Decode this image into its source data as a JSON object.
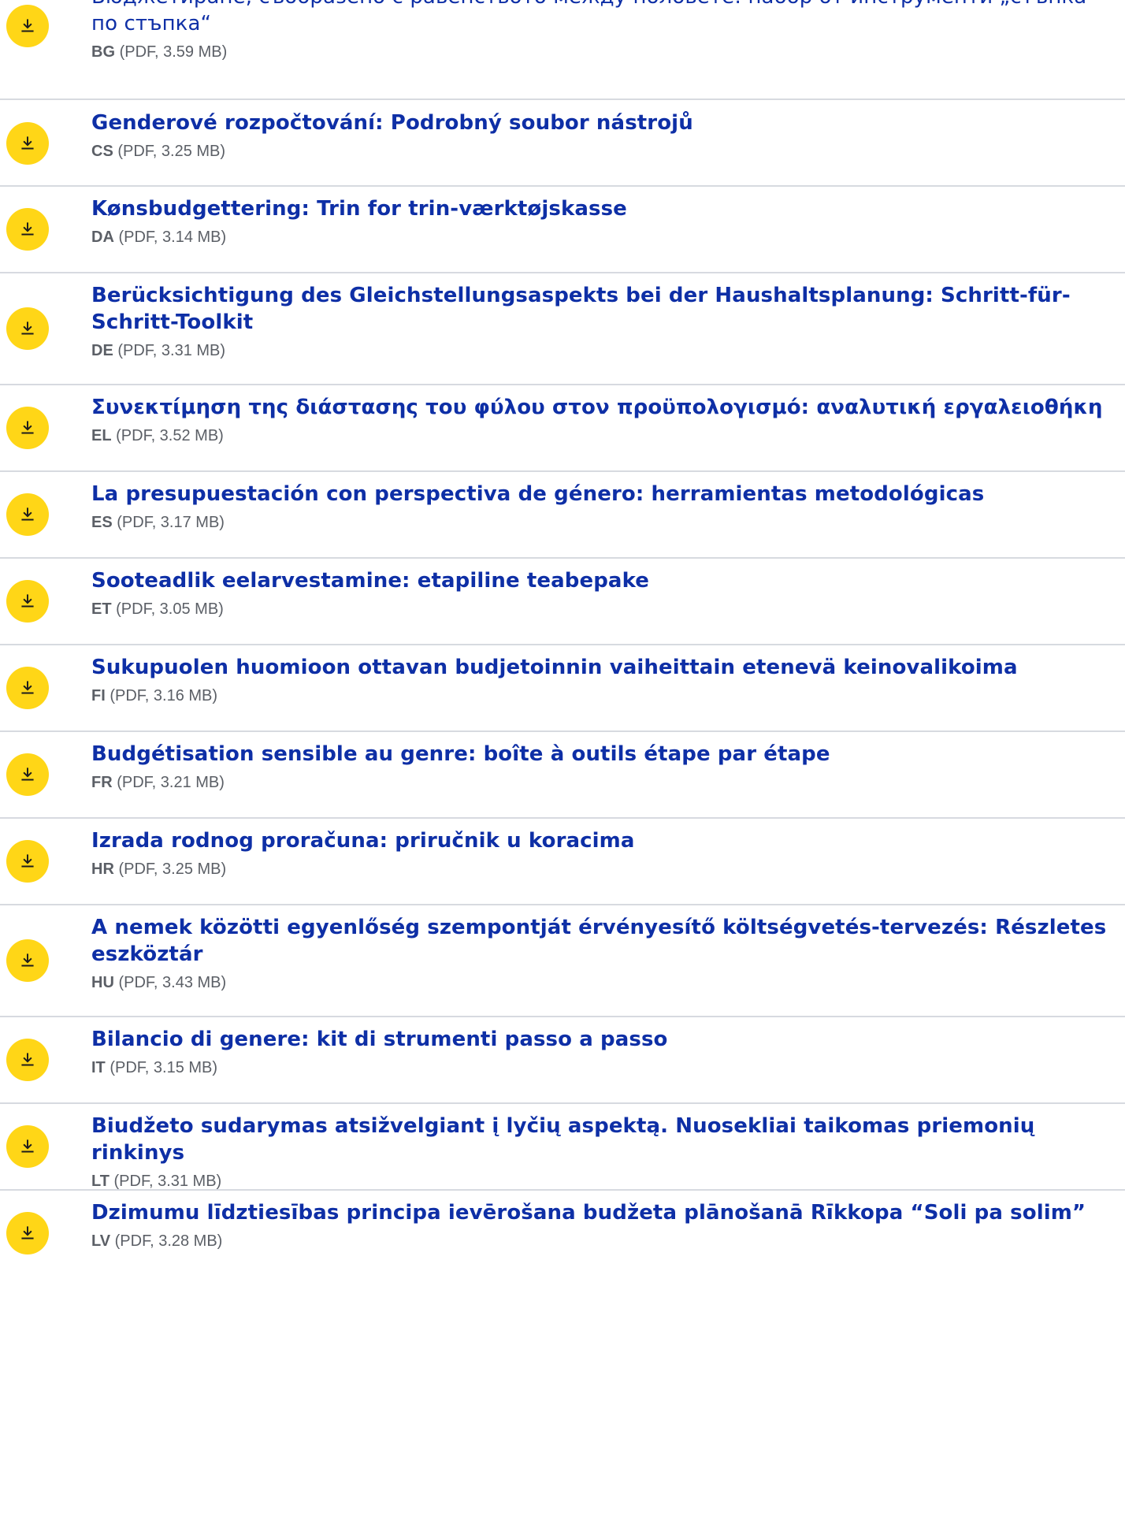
{
  "documents": [
    {
      "title": "Бюджетиране, съобразено с равенството между половете: набор от инструменти „стъпка по стъпка“",
      "lang": "BG",
      "info": "(PDF, 3.59 MB)"
    },
    {
      "title": "Genderové rozpočtování: Podrobný soubor nástrojů",
      "lang": "CS",
      "info": "(PDF, 3.25 MB)"
    },
    {
      "title": "Kønsbudgettering: Trin for trin-værktøjskasse",
      "lang": "DA",
      "info": "(PDF, 3.14 MB)"
    },
    {
      "title": "Berücksichtigung des Gleichstellungsaspekts bei der Haushaltsplanung: Schritt-für-Schritt-Toolkit",
      "lang": "DE",
      "info": "(PDF, 3.31 MB)"
    },
    {
      "title": "Συνεκτίμηση της διάστασης του φύλου στον προϋπολογισμό: αναλυτική εργαλειοθήκη",
      "lang": "EL",
      "info": "(PDF, 3.52 MB)"
    },
    {
      "title": "La presupuestación con perspectiva de género: herramientas metodológicas",
      "lang": "ES",
      "info": "(PDF, 3.17 MB)"
    },
    {
      "title": "Sooteadlik eelarvestamine: etapiline teabepake",
      "lang": "ET",
      "info": "(PDF, 3.05 MB)"
    },
    {
      "title": "Sukupuolen huomioon ottavan budjetoinnin vaiheittain etenevä keinovalikoima",
      "lang": "FI",
      "info": "(PDF, 3.16 MB)"
    },
    {
      "title": "Budgétisation sensible au genre: boîte à outils étape par étape",
      "lang": "FR",
      "info": "(PDF, 3.21 MB)"
    },
    {
      "title": "Izrada rodnog proračuna: priručnik u koracima",
      "lang": "HR",
      "info": "(PDF, 3.25 MB)"
    },
    {
      "title": "A nemek közötti egyenlőség szempontját érvényesítő költségvetés-tervezés: Részletes eszköztár",
      "lang": "HU",
      "info": "(PDF, 3.43 MB)"
    },
    {
      "title": "Bilancio di genere: kit di strumenti passo a passo",
      "lang": "IT",
      "info": "(PDF, 3.15 MB)"
    },
    {
      "title": "Biudžeto sudarymas atsižvelgiant į lyčių aspektą. Nuosekliai taikomas priemonių rinkinys",
      "lang": "LT",
      "info": "(PDF, 3.31 MB)"
    },
    {
      "title": "Dzimumu līdztiesības principa ievērošana budžeta plānošanā Rīkkopa “Soli pa solim”",
      "lang": "LV",
      "info": "(PDF, 3.28 MB)"
    }
  ],
  "icons": {
    "download_button": "download-icon"
  },
  "colors": {
    "accent": "#ffd617",
    "link": "#0e2fa6",
    "meta": "#5b5f66",
    "divider": "#d7dae0"
  }
}
